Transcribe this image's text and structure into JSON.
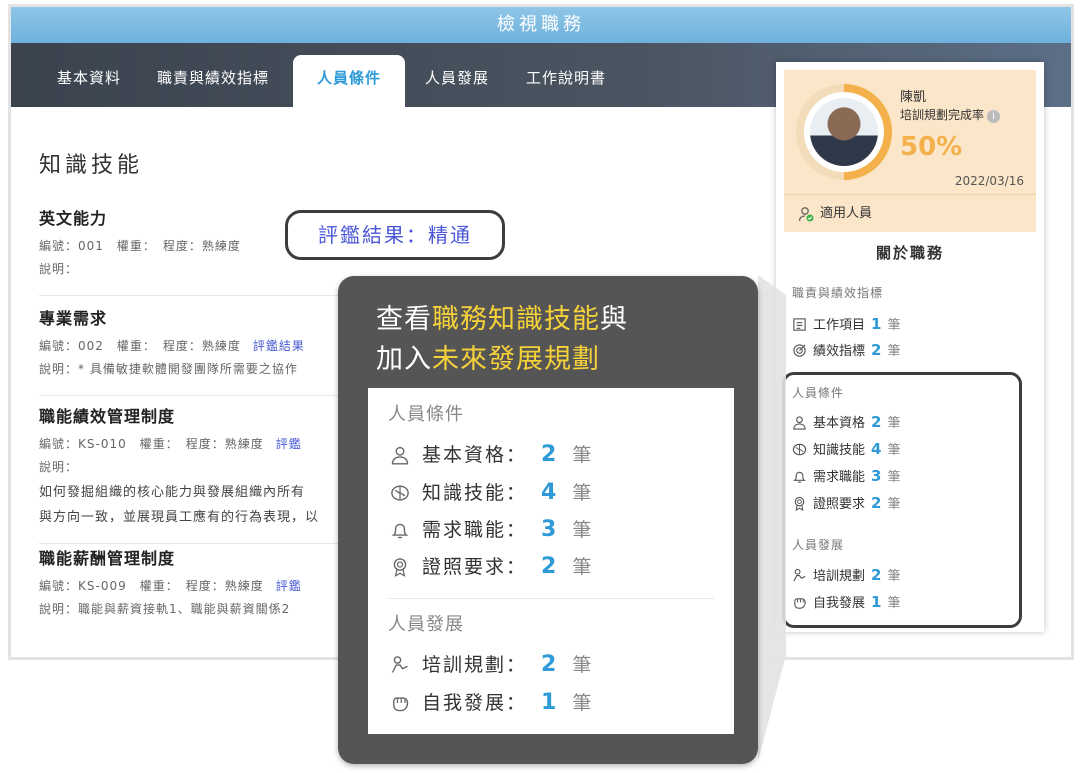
{
  "window": {
    "title": "檢視職務"
  },
  "tabs": [
    {
      "label": "基本資料"
    },
    {
      "label": "職責與績效指標"
    },
    {
      "label": "人員條件",
      "active": true
    },
    {
      "label": "人員發展"
    },
    {
      "label": "工作說明書"
    }
  ],
  "section": {
    "title": "知識技能"
  },
  "items": [
    {
      "name": "英文能力",
      "meta": "編號：001　權重：　程度：熟練度",
      "desc": "說明："
    },
    {
      "name": "專業需求",
      "meta": "編號：002　權重：　程度：熟練度",
      "eval": "評鑑結果",
      "desc": "說明：* 具備敏捷軟體開發團隊所需要之協作"
    },
    {
      "name": "職能績效管理制度",
      "meta": "編號：KS-010　權重：　程度：熟練度",
      "eval": "評鑑",
      "desc": "說明：",
      "body1": "如何發掘組織的核心能力與發展組織內所有",
      "body2": "與方向一致，並展現員工應有的行為表現，以"
    },
    {
      "name": "職能薪酬管理制度",
      "meta": "編號：KS-009　權重：　程度：熟練度",
      "eval": "評鑑",
      "desc": "說明：職能與薪資接軌1、職能與薪資關係2"
    }
  ],
  "eval_callout": "評鑑結果：精通",
  "profile": {
    "name": "陳凱",
    "rate_label": "培訓規劃完成率",
    "rate_percent": 50,
    "rate_text": "50%",
    "date": "2022/03/16",
    "applicable_label": "適用人員",
    "colors": {
      "accent": "#f4b04a",
      "count": "#2e9ad8"
    }
  },
  "about": {
    "title": "關於職務",
    "groups": [
      {
        "title": "職責與績效指標",
        "rows": [
          {
            "icon": "task-list-icon",
            "label": "工作項目",
            "count": "1",
            "unit": "筆"
          },
          {
            "icon": "target-icon",
            "label": "績效指標",
            "count": "2",
            "unit": "筆"
          }
        ]
      },
      {
        "title": "人員條件",
        "rows": [
          {
            "icon": "person-icon",
            "label": "基本資格",
            "count": "2",
            "unit": "筆"
          },
          {
            "icon": "brain-icon",
            "label": "知識技能",
            "count": "4",
            "unit": "筆"
          },
          {
            "icon": "bell-icon",
            "label": "需求職能",
            "count": "3",
            "unit": "筆"
          },
          {
            "icon": "badge-icon",
            "label": "證照要求",
            "count": "2",
            "unit": "筆"
          }
        ]
      },
      {
        "title": "人員發展",
        "rows": [
          {
            "icon": "training-icon",
            "label": "培訓規劃",
            "count": "2",
            "unit": "筆"
          },
          {
            "icon": "fist-icon",
            "label": "自我發展",
            "count": "1",
            "unit": "筆"
          }
        ]
      }
    ]
  },
  "overlay": {
    "line1_pre": "查看",
    "line1_hl": "職務知識技能",
    "line1_post": "與",
    "line2_pre": "加入",
    "line2_hl": "未來發展規劃",
    "groups": [
      {
        "title": "人員條件",
        "rows": [
          {
            "label": "基本資格",
            "count": "2",
            "unit": "筆"
          },
          {
            "label": "知識技能",
            "count": "4",
            "unit": "筆"
          },
          {
            "label": "需求職能",
            "count": "3",
            "unit": "筆"
          },
          {
            "label": "證照要求",
            "count": "2",
            "unit": "筆"
          }
        ]
      },
      {
        "title": "人員發展",
        "rows": [
          {
            "label": "培訓規劃",
            "count": "2",
            "unit": "筆"
          },
          {
            "label": "自我發展",
            "count": "1",
            "unit": "筆"
          }
        ]
      }
    ]
  }
}
